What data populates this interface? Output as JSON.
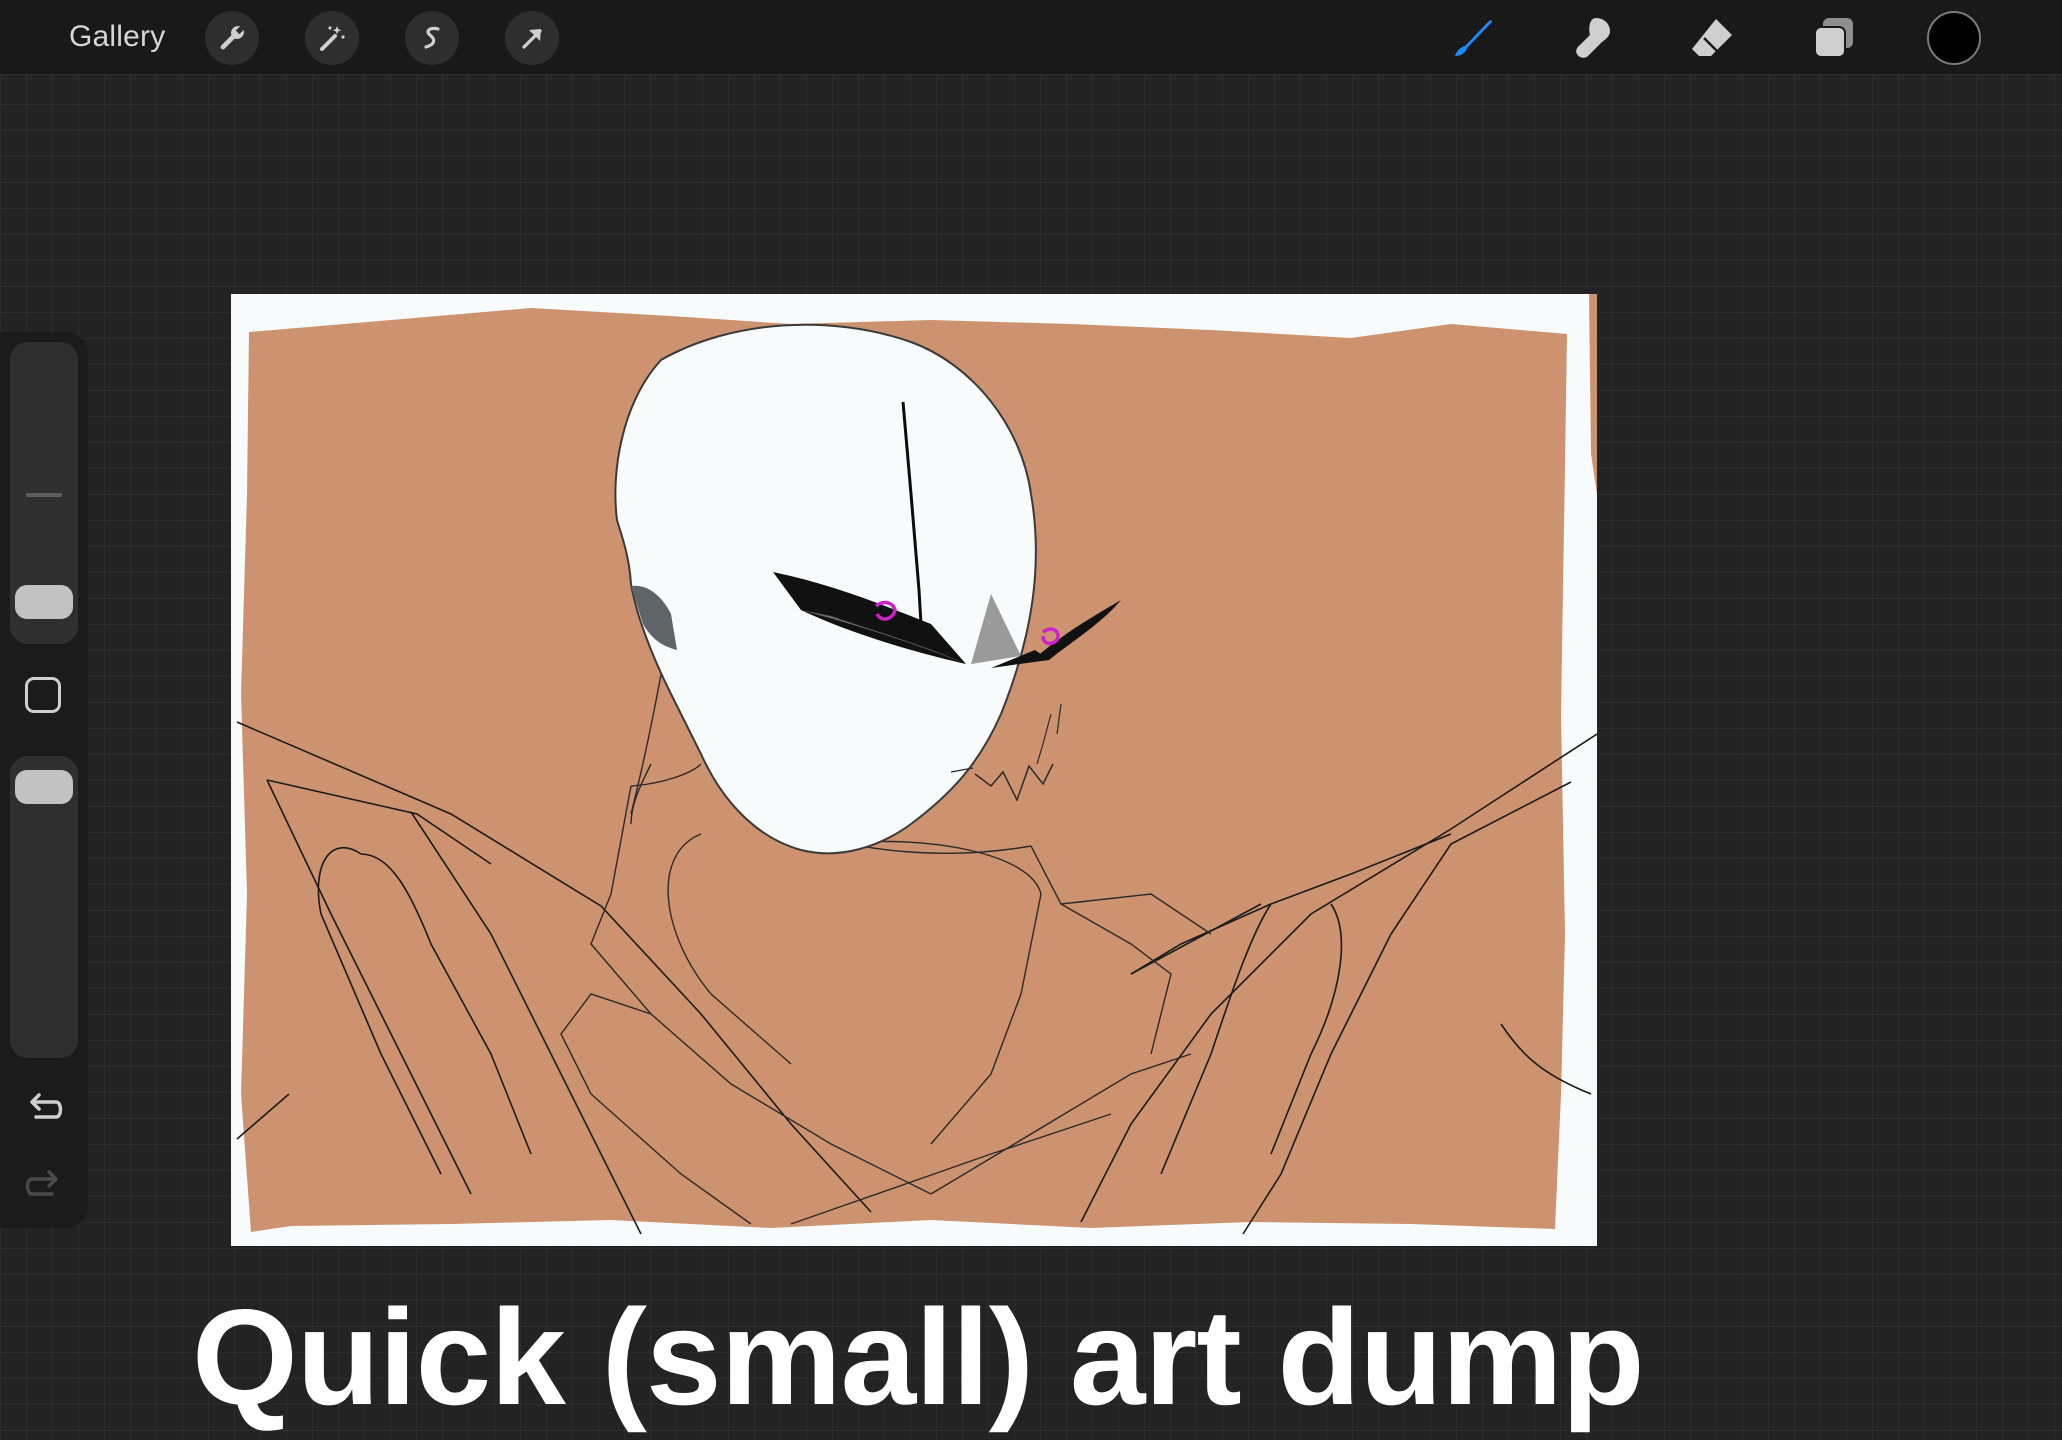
{
  "app": {
    "gallery_label": "Gallery"
  },
  "toolbar": {
    "left_tools": [
      "wrench-icon",
      "magic-wand-icon",
      "selection-s-icon",
      "transform-arrow-icon"
    ],
    "right_tools": [
      "brush-icon",
      "smudge-icon",
      "eraser-icon",
      "layers-icon",
      "color-well"
    ],
    "active_tool": "brush",
    "active_tool_color": "#1a8cff",
    "current_color": "#000000"
  },
  "sidebar": {
    "brush_size_level": 0.8,
    "opacity_level": 1.0,
    "items": [
      "brush-size-slider",
      "modify-button",
      "opacity-slider",
      "undo-icon",
      "redo-icon"
    ]
  },
  "artwork": {
    "background_fill": "#cd9370",
    "paper_color": "#f7fbfb",
    "eye_accent": "#cc22cc"
  },
  "overlay": {
    "caption": "Quick (small) art dump"
  }
}
